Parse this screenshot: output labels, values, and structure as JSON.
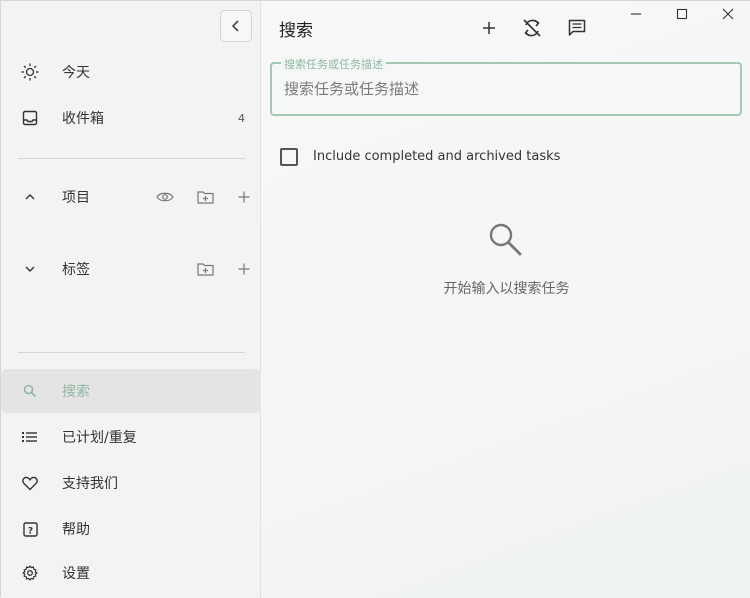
{
  "sidebar": {
    "items": [
      {
        "label": "今天",
        "icon": "sun-icon"
      },
      {
        "label": "收件箱",
        "icon": "inbox-icon",
        "count": "4"
      },
      {
        "label": "项目",
        "icon": "chevron-up-icon"
      },
      {
        "label": "标签",
        "icon": "chevron-down-icon"
      },
      {
        "label": "搜索",
        "icon": "search-icon",
        "active": true
      },
      {
        "label": "已计划/重复",
        "icon": "list-icon"
      },
      {
        "label": "支持我们",
        "icon": "heart-icon"
      },
      {
        "label": "帮助",
        "icon": "help-icon"
      },
      {
        "label": "设置",
        "icon": "gear-icon"
      }
    ]
  },
  "main": {
    "title": "搜索",
    "search": {
      "legend": "搜索任务或任务描述",
      "placeholder": "搜索任务或任务描述",
      "value": ""
    },
    "include_completed_label": "Include completed and archived tasks",
    "include_completed_checked": false,
    "empty_text": "开始输入以搜索任务"
  },
  "colors": {
    "accent": "#8fb9a3",
    "border_accent": "#a4c8b4",
    "active_bg": "#e4e4e4"
  }
}
